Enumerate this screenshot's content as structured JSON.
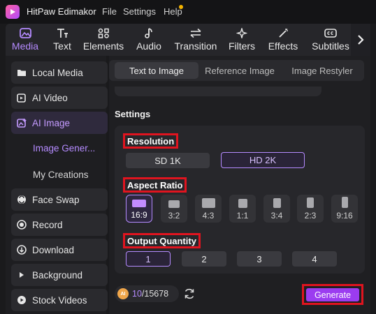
{
  "app": {
    "title": "HitPaw Edimakor"
  },
  "menu": {
    "file": "File",
    "settings": "Settings",
    "help": "Help"
  },
  "toolbar": {
    "items": [
      {
        "label": "Media",
        "icon": "media-icon",
        "active": true
      },
      {
        "label": "Text",
        "icon": "text-icon"
      },
      {
        "label": "Elements",
        "icon": "elements-icon"
      },
      {
        "label": "Audio",
        "icon": "audio-note-icon"
      },
      {
        "label": "Transition",
        "icon": "transition-arrows-icon"
      },
      {
        "label": "Filters",
        "icon": "filters-sparkle-icon"
      },
      {
        "label": "Effects",
        "icon": "effects-wand-icon"
      },
      {
        "label": "Subtitles",
        "icon": "subtitles-cc-icon"
      }
    ],
    "next_icon": "chevron-right-icon"
  },
  "sidebar": {
    "items": [
      {
        "label": "Local Media",
        "icon": "folder-icon"
      },
      {
        "label": "AI Video",
        "icon": "ai-video-icon"
      },
      {
        "label": "AI Image",
        "icon": "ai-image-icon",
        "active": true
      },
      {
        "label": "Image Gener...",
        "sub": true,
        "active": true
      },
      {
        "label": "My Creations",
        "sub": true
      },
      {
        "label": "Face Swap",
        "icon": "face-swap-icon"
      },
      {
        "label": "Record",
        "icon": "record-icon"
      },
      {
        "label": "Download",
        "icon": "download-icon"
      },
      {
        "label": "Background",
        "icon": "triangle-right-icon"
      },
      {
        "label": "Stock Videos",
        "icon": "play-icon"
      }
    ]
  },
  "tabs": [
    {
      "label": "Text to Image",
      "active": true
    },
    {
      "label": "Reference Image"
    },
    {
      "label": "Image Restyler"
    }
  ],
  "settings": {
    "title": "Settings",
    "resolution": {
      "label": "Resolution",
      "options": [
        "SD 1K",
        "HD 2K"
      ],
      "selected": "HD 2K"
    },
    "aspect_ratio": {
      "label": "Aspect Ratio",
      "options": [
        "16:9",
        "3:2",
        "4:3",
        "1:1",
        "3:4",
        "2:3",
        "9:16"
      ],
      "selected": "16:9"
    },
    "output_quantity": {
      "label": "Output Quantity",
      "options": [
        "1",
        "2",
        "3",
        "4"
      ],
      "selected": "1"
    }
  },
  "footer": {
    "coin_label": "AI",
    "credits_used": "10",
    "credits_total": "/15678",
    "generate_label": "Generate"
  },
  "colors": {
    "accent": "#b58bff",
    "generate": "#9b3cf0",
    "highlight_box": "#e0141f"
  }
}
